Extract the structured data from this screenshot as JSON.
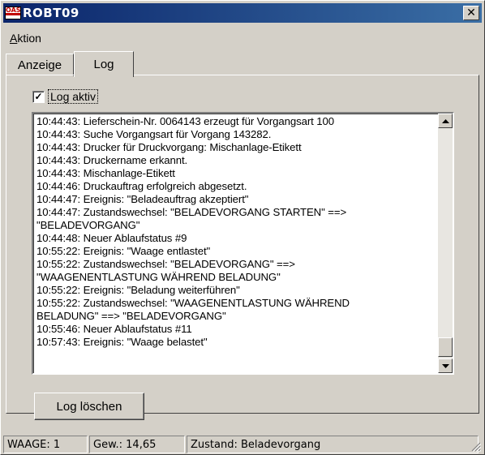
{
  "window": {
    "title": "ROBT09",
    "icon_text": "OAS",
    "close_symbol": "✕"
  },
  "menu": {
    "items": [
      {
        "mnemonic": "A",
        "rest": "ktion"
      }
    ]
  },
  "tabs": [
    {
      "label": "Anzeige"
    },
    {
      "label": "Log"
    }
  ],
  "log_panel": {
    "checkbox_label": "Log aktiv",
    "checkbox_mark": "✓",
    "checked": true,
    "lines": [
      "10:44:43: Lieferschein-Nr. 0064143 erzeugt für Vorgangsart 100",
      "10:44:43: Suche Vorgangsart für Vorgang 143282.",
      "10:44:43: Drucker für Druckvorgang: Mischanlage-Etikett",
      "10:44:43: Druckername erkannt.",
      "10:44:43: Mischanlage-Etikett",
      "10:44:46: Druckauftrag erfolgreich abgesetzt.",
      "10:44:47: Ereignis: \"Beladeauftrag akzeptiert\"",
      "10:44:47: Zustandswechsel: \"BELADEVORGANG STARTEN\" ==>",
      "\"BELADEVORGANG\"",
      "10:44:48: Neuer Ablaufstatus #9",
      "10:55:22: Ereignis: \"Waage entlastet\"",
      "10:55:22: Zustandswechsel: \"BELADEVORGANG\" ==>",
      "\"WAAGENENTLASTUNG WÄHREND BELADUNG\"",
      "10:55:22: Ereignis: \"Beladung weiterführen\"",
      "10:55:22: Zustandswechsel: \"WAAGENENTLASTUNG WÄHREND",
      "BELADUNG\" ==> \"BELADEVORGANG\"",
      "10:55:46: Neuer Ablaufstatus #11",
      "10:57:43: Ereignis: \"Waage belastet\""
    ],
    "clear_button": "Log löschen"
  },
  "statusbar": {
    "waage": "WAAGE: 1",
    "gewicht": "Gew.: 14,65",
    "zustand": "Zustand: Beladevorgang"
  },
  "colors": {
    "titlebar_start": "#0a246a",
    "titlebar_end": "#3a6ea5",
    "face": "#d4d0c8"
  }
}
